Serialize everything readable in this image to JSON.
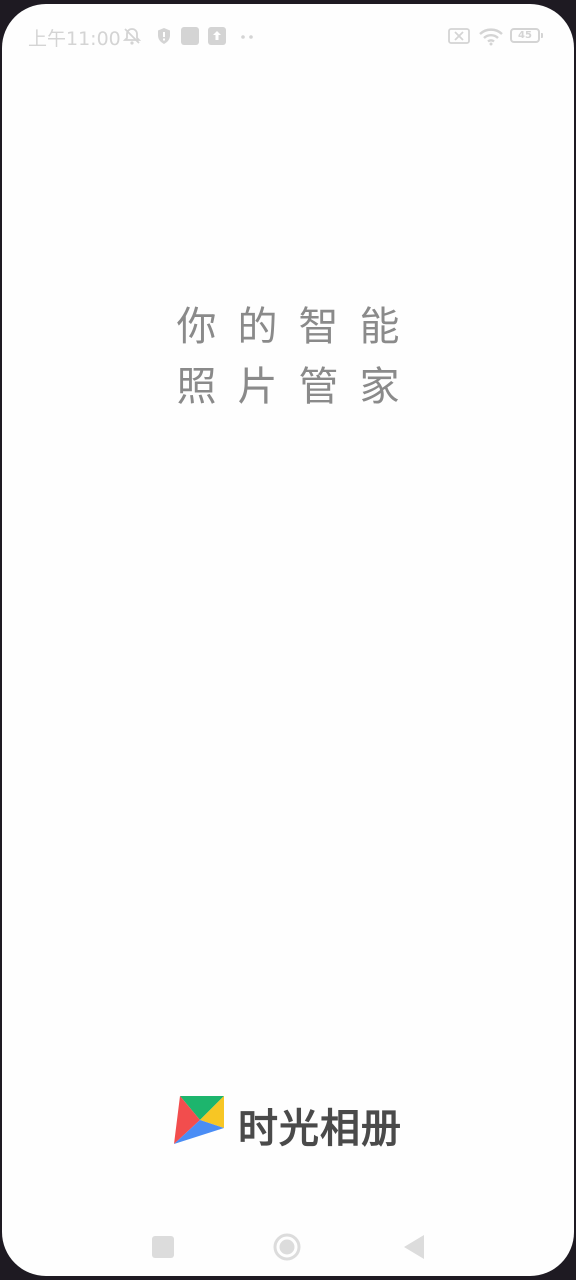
{
  "status_bar": {
    "time": "上午11:00",
    "battery": "45",
    "icons": [
      "mute-bell-icon",
      "shield-icon",
      "gallery-notification-icon",
      "upload-icon",
      "more-dots-icon",
      "sim-off-icon",
      "wifi-icon",
      "battery-icon"
    ]
  },
  "splash": {
    "slogan_line1": "你的智能",
    "slogan_line2": "照片管家"
  },
  "brand": {
    "name": "时光相册",
    "logo": "kite-logo",
    "colors": [
      "#1db56d",
      "#f7c624",
      "#f24d4d",
      "#4a8df5"
    ]
  },
  "nav_bar": {
    "buttons": [
      "recent-apps-button",
      "home-button",
      "back-button"
    ]
  }
}
